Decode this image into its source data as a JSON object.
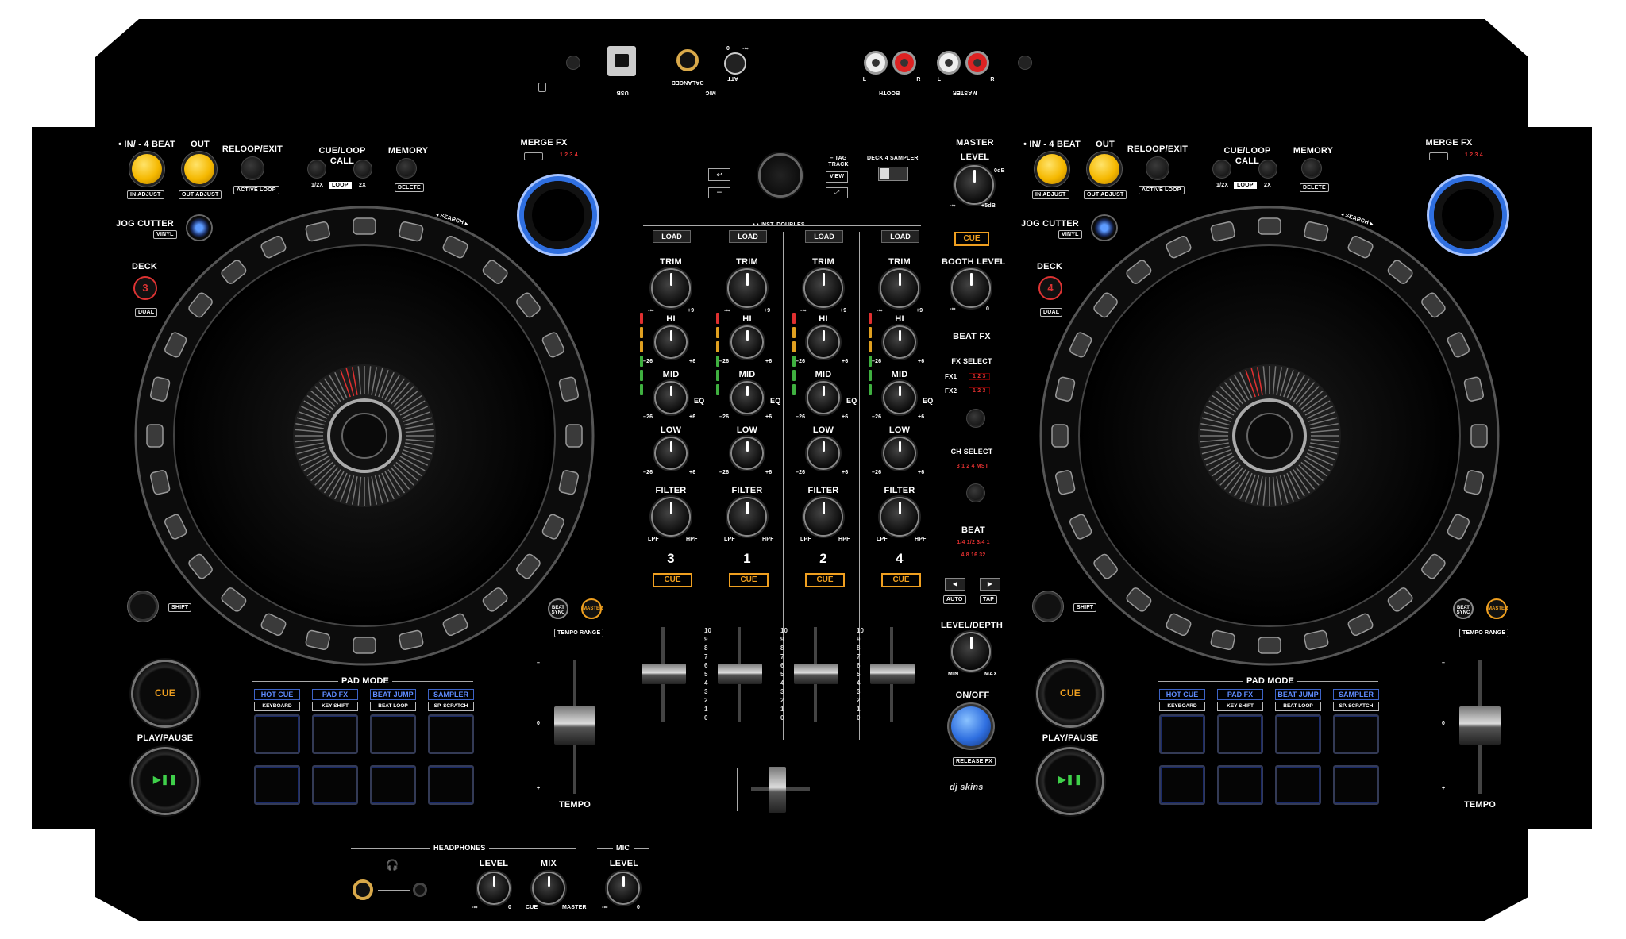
{
  "top": {
    "usb": "USB",
    "mic": "MIC",
    "balanced": "BALANCED",
    "att": "ATT",
    "att_zero": "0",
    "att_inf": "-∞",
    "booth": "BOOTH",
    "master": "MASTER",
    "l": "L",
    "r": "R"
  },
  "deck_left": {
    "in_beat": "• IN/ - 4 BEAT",
    "in_adjust": "IN ADJUST",
    "out": "OUT",
    "out_adjust": "OUT ADJUST",
    "reloop": "RELOOP/EXIT",
    "active_loop": "ACTIVE LOOP",
    "cue_loop": "CUE/LOOP",
    "call": "CALL",
    "half": "1/2X",
    "loop": "LOOP",
    "double": "2X",
    "memory": "MEMORY",
    "delete": "DELETE",
    "merge_fx": "MERGE FX",
    "merge_nums": "1 2 3 4",
    "jog_cutter": "JOG CUTTER",
    "vinyl": "VINYL",
    "deck": "DECK",
    "deck_num": "3",
    "dual": "DUAL",
    "search": "◂ SEARCH ▸",
    "shift": "SHIFT",
    "beat_sync": "BEAT SYNC",
    "master_btn": "MASTER",
    "tempo_range": "TEMPO RANGE",
    "cue": "CUE",
    "play_pause": "PLAY/PAUSE",
    "play_icon": "▶❚❚",
    "pad_mode": "PAD MODE",
    "pad_modes": [
      "HOT CUE",
      "PAD FX",
      "BEAT JUMP",
      "SAMPLER"
    ],
    "pad_subs": [
      "KEYBOARD",
      "KEY SHIFT",
      "BEAT LOOP",
      "SP. SCRATCH"
    ],
    "tempo": "TEMPO",
    "tempo_zero": "0",
    "tempo_minus": "–",
    "tempo_plus": "+"
  },
  "deck_right": {
    "in_beat": "• IN/ - 4 BEAT",
    "in_adjust": "IN ADJUST",
    "out": "OUT",
    "out_adjust": "OUT ADJUST",
    "reloop": "RELOOP/EXIT",
    "active_loop": "ACTIVE LOOP",
    "cue_loop": "CUE/LOOP",
    "call": "CALL",
    "half": "1/2X",
    "loop": "LOOP",
    "double": "2X",
    "memory": "MEMORY",
    "delete": "DELETE",
    "merge_fx": "MERGE FX",
    "merge_nums": "1 2 3 4",
    "jog_cutter": "JOG CUTTER",
    "vinyl": "VINYL",
    "deck": "DECK",
    "deck_num": "4",
    "dual": "DUAL",
    "search": "◂ SEARCH ▸",
    "shift": "SHIFT",
    "beat_sync": "BEAT SYNC",
    "master_btn": "MASTER",
    "tempo_range": "TEMPO RANGE",
    "cue": "CUE",
    "play_pause": "PLAY/PAUSE",
    "play_icon": "▶❚❚",
    "pad_mode": "PAD MODE",
    "pad_modes": [
      "HOT CUE",
      "PAD FX",
      "BEAT JUMP",
      "SAMPLER"
    ],
    "pad_subs": [
      "KEYBOARD",
      "KEY SHIFT",
      "BEAT LOOP",
      "SP. SCRATCH"
    ],
    "tempo": "TEMPO",
    "tempo_zero": "0",
    "tempo_minus": "–",
    "tempo_plus": "+"
  },
  "mixer": {
    "tag_track": "– TAG TRACK",
    "view": "VIEW",
    "deck4_sampler": "DECK 4  SAMPLER",
    "inst_doubles": "• • INST. DOUBLES",
    "load": "LOAD",
    "trim": "TRIM",
    "hi": "HI",
    "mid": "MID",
    "low": "LOW",
    "eq": "EQ",
    "filter": "FILTER",
    "lpf": "LPF",
    "hpf": "HPF",
    "cue": "CUE",
    "minus_inf": "-∞",
    "plus9": "+9",
    "minus26": "–26",
    "plus6": "+6",
    "channels": [
      "3",
      "1",
      "2",
      "4"
    ],
    "fader_scale": [
      "10",
      "9",
      "8",
      "7",
      "6",
      "5",
      "4",
      "3",
      "2",
      "1",
      "0"
    ]
  },
  "master_section": {
    "master": "MASTER",
    "level": "LEVEL",
    "zero_db": "0dB",
    "plus5": "+5dB",
    "minus_inf": "-∞",
    "cue": "CUE",
    "booth_level": "BOOTH LEVEL",
    "zero": "0",
    "beat_fx": "BEAT FX",
    "fx_select": "FX SELECT",
    "fx1": "FX1",
    "fx2": "FX2",
    "fx_nums": "1  2  3",
    "ch_select": "CH SELECT",
    "ch_nums": "3  1  2  4  MST",
    "beat": "BEAT",
    "beat_row1": "1/4  1/2  3/4  1",
    "beat_row2": "4  8  16  32",
    "auto": "AUTO",
    "tap": "TAP",
    "level_depth": "LEVEL/DEPTH",
    "min": "MIN",
    "max": "MAX",
    "on_off": "ON/OFF",
    "release_fx": "RELEASE FX",
    "brand": "dj skins"
  },
  "bottom": {
    "headphones": "HEADPHONES",
    "level": "LEVEL",
    "mix": "MIX",
    "mic": "MIC",
    "mic_level": "LEVEL",
    "minus_inf": "-∞",
    "zero": "0",
    "cue": "CUE",
    "master": "MASTER"
  },
  "colors": {
    "body": "#000000",
    "accent_yellow": "#f5b800",
    "accent_blue": "#2f6fe0",
    "accent_orange": "#f0a020",
    "led_red": "#e03030",
    "pad_blue": "#3d63c6"
  }
}
